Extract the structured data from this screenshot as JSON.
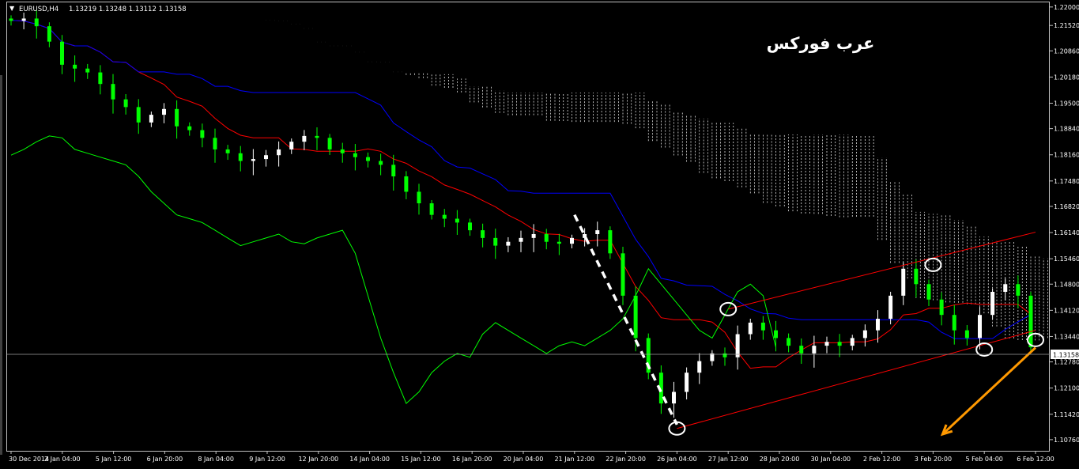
{
  "chart_data": {
    "type": "candlestick",
    "header": {
      "marker": "▼",
      "title": "EURUSD,H4",
      "ohlc": "1.13219 1.13248 1.13112 1.13158"
    },
    "watermark": "عرب فوركس",
    "y_ticks": [
      "1.22000",
      "1.21520",
      "1.20860",
      "1.20180",
      "1.19500",
      "1.18840",
      "1.18160",
      "1.17480",
      "1.16820",
      "1.16140",
      "1.15460",
      "1.14800",
      "1.14120",
      "1.13440",
      "1.12780",
      "1.12100",
      "1.11420",
      "1.10760"
    ],
    "x_ticks": [
      "30 Dec 2014",
      "2 Jan 04:00",
      "5 Jan 12:00",
      "6 Jan 20:00",
      "8 Jan 04:00",
      "9 Jan 12:00",
      "12 Jan 20:00",
      "14 Jan 04:00",
      "15 Jan 12:00",
      "16 Jan 20:00",
      "20 Jan 04:00",
      "21 Jan 12:00",
      "22 Jan 20:00",
      "26 Jan 04:00",
      "27 Jan 12:00",
      "28 Jan 20:00",
      "30 Jan 04:00",
      "2 Feb 12:00",
      "3 Feb 20:00",
      "5 Feb 04:00",
      "6 Feb 12:00"
    ],
    "current_price": 1.13158,
    "current_price_label": "1.13158",
    "ylim": [
      1.1047,
      1.2212
    ],
    "colors": {
      "background": "#000000",
      "bull": "#ffffff",
      "bear": "#00ff00",
      "tenkan": "#ff0000",
      "kijun": "#0000ff",
      "chikou": "#00ff00",
      "kumo": "#ffffff",
      "channel": "#ff0000",
      "arrow": "#ff9900",
      "annotation": "#ffffff"
    },
    "indicators": [
      "candles",
      "tenkan-sen",
      "kijun-sen",
      "chikou-span",
      "kumo-cloud"
    ],
    "annotations": {
      "channel_lines": [
        [
          [
            "26 Jan 04:00",
            1.1105
          ],
          [
            "6 Feb 12:00",
            1.136
          ]
        ],
        [
          [
            "27 Jan 12:00",
            1.1415
          ],
          [
            "6 Feb 12:00",
            1.1615
          ]
        ]
      ],
      "dashed_line": [
        [
          "21 Jan 12:00",
          1.166
        ],
        [
          "26 Jan 04:00",
          1.1115
        ]
      ],
      "circles": [
        [
          "26 Jan 04:00",
          1.1105
        ],
        [
          "27 Jan 12:00",
          1.1415
        ],
        [
          "3 Feb 20:00",
          1.153
        ],
        [
          "5 Feb 04:00",
          1.131
        ],
        [
          "6 Feb 12:00",
          1.1335
        ]
      ],
      "arrow": [
        [
          "6 Feb 12:00",
          1.1315
        ],
        [
          "3 Feb 20:00",
          1.109
        ]
      ]
    },
    "close_series": [
      1.2164,
      1.217,
      1.215,
      1.211,
      1.205,
      1.204,
      1.203,
      1.2,
      1.196,
      1.194,
      1.19,
      1.192,
      1.1935,
      1.189,
      1.188,
      1.186,
      1.183,
      1.182,
      1.18,
      1.1805,
      1.1815,
      1.183,
      1.185,
      1.1865,
      1.186,
      1.183,
      1.182,
      1.181,
      1.18,
      1.179,
      1.176,
      1.172,
      1.169,
      1.166,
      1.165,
      1.164,
      1.162,
      1.16,
      1.158,
      1.159,
      1.16,
      1.161,
      1.159,
      1.1585,
      1.16,
      1.161,
      1.162,
      1.156,
      1.145,
      1.134,
      1.125,
      1.117,
      1.12,
      1.125,
      1.128,
      1.13,
      1.129,
      1.135,
      1.138,
      1.136,
      1.134,
      1.132,
      1.13,
      1.132,
      1.133,
      1.132,
      1.134,
      1.136,
      1.139,
      1.145,
      1.152,
      1.148,
      1.144,
      1.14,
      1.136,
      1.134,
      1.14,
      1.146,
      1.148,
      1.145,
      1.1316
    ]
  }
}
